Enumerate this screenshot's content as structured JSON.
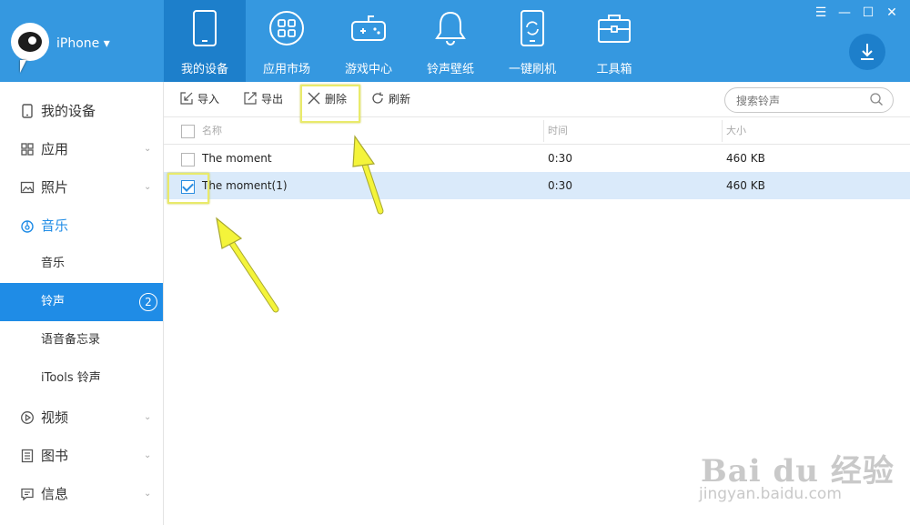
{
  "app": {
    "device_name": "iPhone ▾"
  },
  "nav": {
    "items": [
      {
        "label": "我的设备",
        "icon": "tablet-icon"
      },
      {
        "label": "应用市场",
        "icon": "apps-grid-icon"
      },
      {
        "label": "游戏中心",
        "icon": "gamepad-icon"
      },
      {
        "label": "铃声壁纸",
        "icon": "bell-icon"
      },
      {
        "label": "一键刷机",
        "icon": "flash-device-icon"
      },
      {
        "label": "工具箱",
        "icon": "toolbox-icon"
      }
    ],
    "active_index": 0
  },
  "window_controls": {
    "menu": "☰",
    "minimize": "—",
    "maximize": "☐",
    "close": "✕"
  },
  "sidebar": {
    "items": [
      {
        "label": "我的设备",
        "icon": "device-icon"
      },
      {
        "label": "应用",
        "icon": "apps-icon",
        "chevron": "⌄"
      },
      {
        "label": "照片",
        "icon": "photo-icon",
        "chevron": "⌄"
      },
      {
        "label": "音乐",
        "icon": "music-icon"
      },
      {
        "label": "音乐"
      },
      {
        "label": "铃声",
        "badge": "2"
      },
      {
        "label": "语音备忘录"
      },
      {
        "label": "iTools 铃声"
      },
      {
        "label": "视频",
        "icon": "video-icon",
        "chevron": "⌄"
      },
      {
        "label": "图书",
        "icon": "book-icon",
        "chevron": "⌄"
      },
      {
        "label": "信息",
        "icon": "message-icon",
        "chevron": "⌄"
      }
    ]
  },
  "toolbar": {
    "import_label": "导入",
    "export_label": "导出",
    "delete_label": "删除",
    "refresh_label": "刷新",
    "search_placeholder": "搜索铃声"
  },
  "table": {
    "columns": [
      "名称",
      "时间",
      "大小"
    ],
    "rows": [
      {
        "name": "The moment",
        "time": "0:30",
        "size": "460 KB",
        "checked": false
      },
      {
        "name": "The moment(1)",
        "time": "0:30",
        "size": "460 KB",
        "checked": true
      }
    ]
  },
  "watermark": {
    "brand": "Bai du 经验",
    "url": "jingyan.baidu.com"
  },
  "colors": {
    "topbar": "#3598e0",
    "active_nav": "#1d7fcb",
    "sidebar_active": "#1f8ce6",
    "row_selected": "#daeafa",
    "annotation": "#e9ea6b"
  }
}
